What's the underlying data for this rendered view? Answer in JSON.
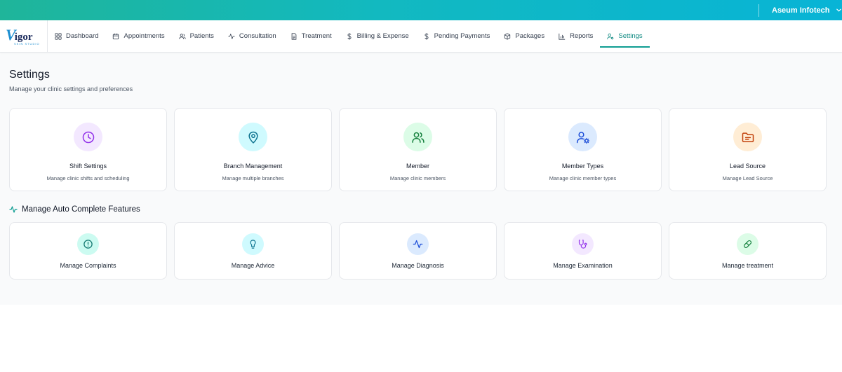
{
  "topbar": {
    "org_name": "Aseum Infotech",
    "gradient_colors": [
      "#1fb59a",
      "#08b4d6"
    ]
  },
  "brand": {
    "name": "Vigor",
    "tagline": "SKIN STUDIO"
  },
  "nav": {
    "items": [
      {
        "label": "Dashboard",
        "icon": "grid-icon"
      },
      {
        "label": "Appointments",
        "icon": "calendar-icon"
      },
      {
        "label": "Patients",
        "icon": "users-icon"
      },
      {
        "label": "Consultation",
        "icon": "activity-icon"
      },
      {
        "label": "Treatment",
        "icon": "document-icon"
      },
      {
        "label": "Billing & Expense",
        "icon": "dollar-icon"
      },
      {
        "label": "Pending Payments",
        "icon": "dollar-icon"
      },
      {
        "label": "Packages",
        "icon": "box-icon"
      },
      {
        "label": "Reports",
        "icon": "bar-chart-icon"
      },
      {
        "label": "Settings",
        "icon": "user-gear-icon",
        "active": true
      }
    ],
    "active_color": "#0f9d92"
  },
  "page": {
    "title": "Settings",
    "subtitle": "Manage your clinic settings and preferences"
  },
  "settings_cards": [
    {
      "title": "Shift Settings",
      "desc": "Manage clinic shifts and scheduling",
      "icon": "clock-icon",
      "bg": "#f3e8ff",
      "fg": "#9333ea"
    },
    {
      "title": "Branch Management",
      "desc": "Manage multiple branches",
      "icon": "map-pin-icon",
      "bg": "#cffafe",
      "fg": "#0e7490"
    },
    {
      "title": "Member",
      "desc": "Manage clinic members",
      "icon": "users-icon",
      "bg": "#dcfce7",
      "fg": "#15803d"
    },
    {
      "title": "Member Types",
      "desc": "Manage clinic member types",
      "icon": "user-gear-icon",
      "bg": "#dbeafe",
      "fg": "#1d4ed8"
    },
    {
      "title": "Lead Source",
      "desc": "Manage Lead Source",
      "icon": "folder-icon",
      "bg": "#ffedd5",
      "fg": "#c2410c"
    }
  ],
  "autocomplete": {
    "heading": "Manage Auto Complete Features",
    "items": [
      {
        "title": "Manage Complaints",
        "icon": "alert-circle-icon",
        "bg": "#ccfbf1",
        "fg": "#0f766e"
      },
      {
        "title": "Manage Advice",
        "icon": "lightbulb-icon",
        "bg": "#cffafe",
        "fg": "#0e7490"
      },
      {
        "title": "Manage Diagnosis",
        "icon": "activity-icon",
        "bg": "#dbeafe",
        "fg": "#1d4ed8"
      },
      {
        "title": "Manage Examination",
        "icon": "stethoscope-icon",
        "bg": "#f3e8ff",
        "fg": "#9333ea"
      },
      {
        "title": "Manage treatment",
        "icon": "pill-icon",
        "bg": "#dcfce7",
        "fg": "#15803d"
      }
    ]
  }
}
